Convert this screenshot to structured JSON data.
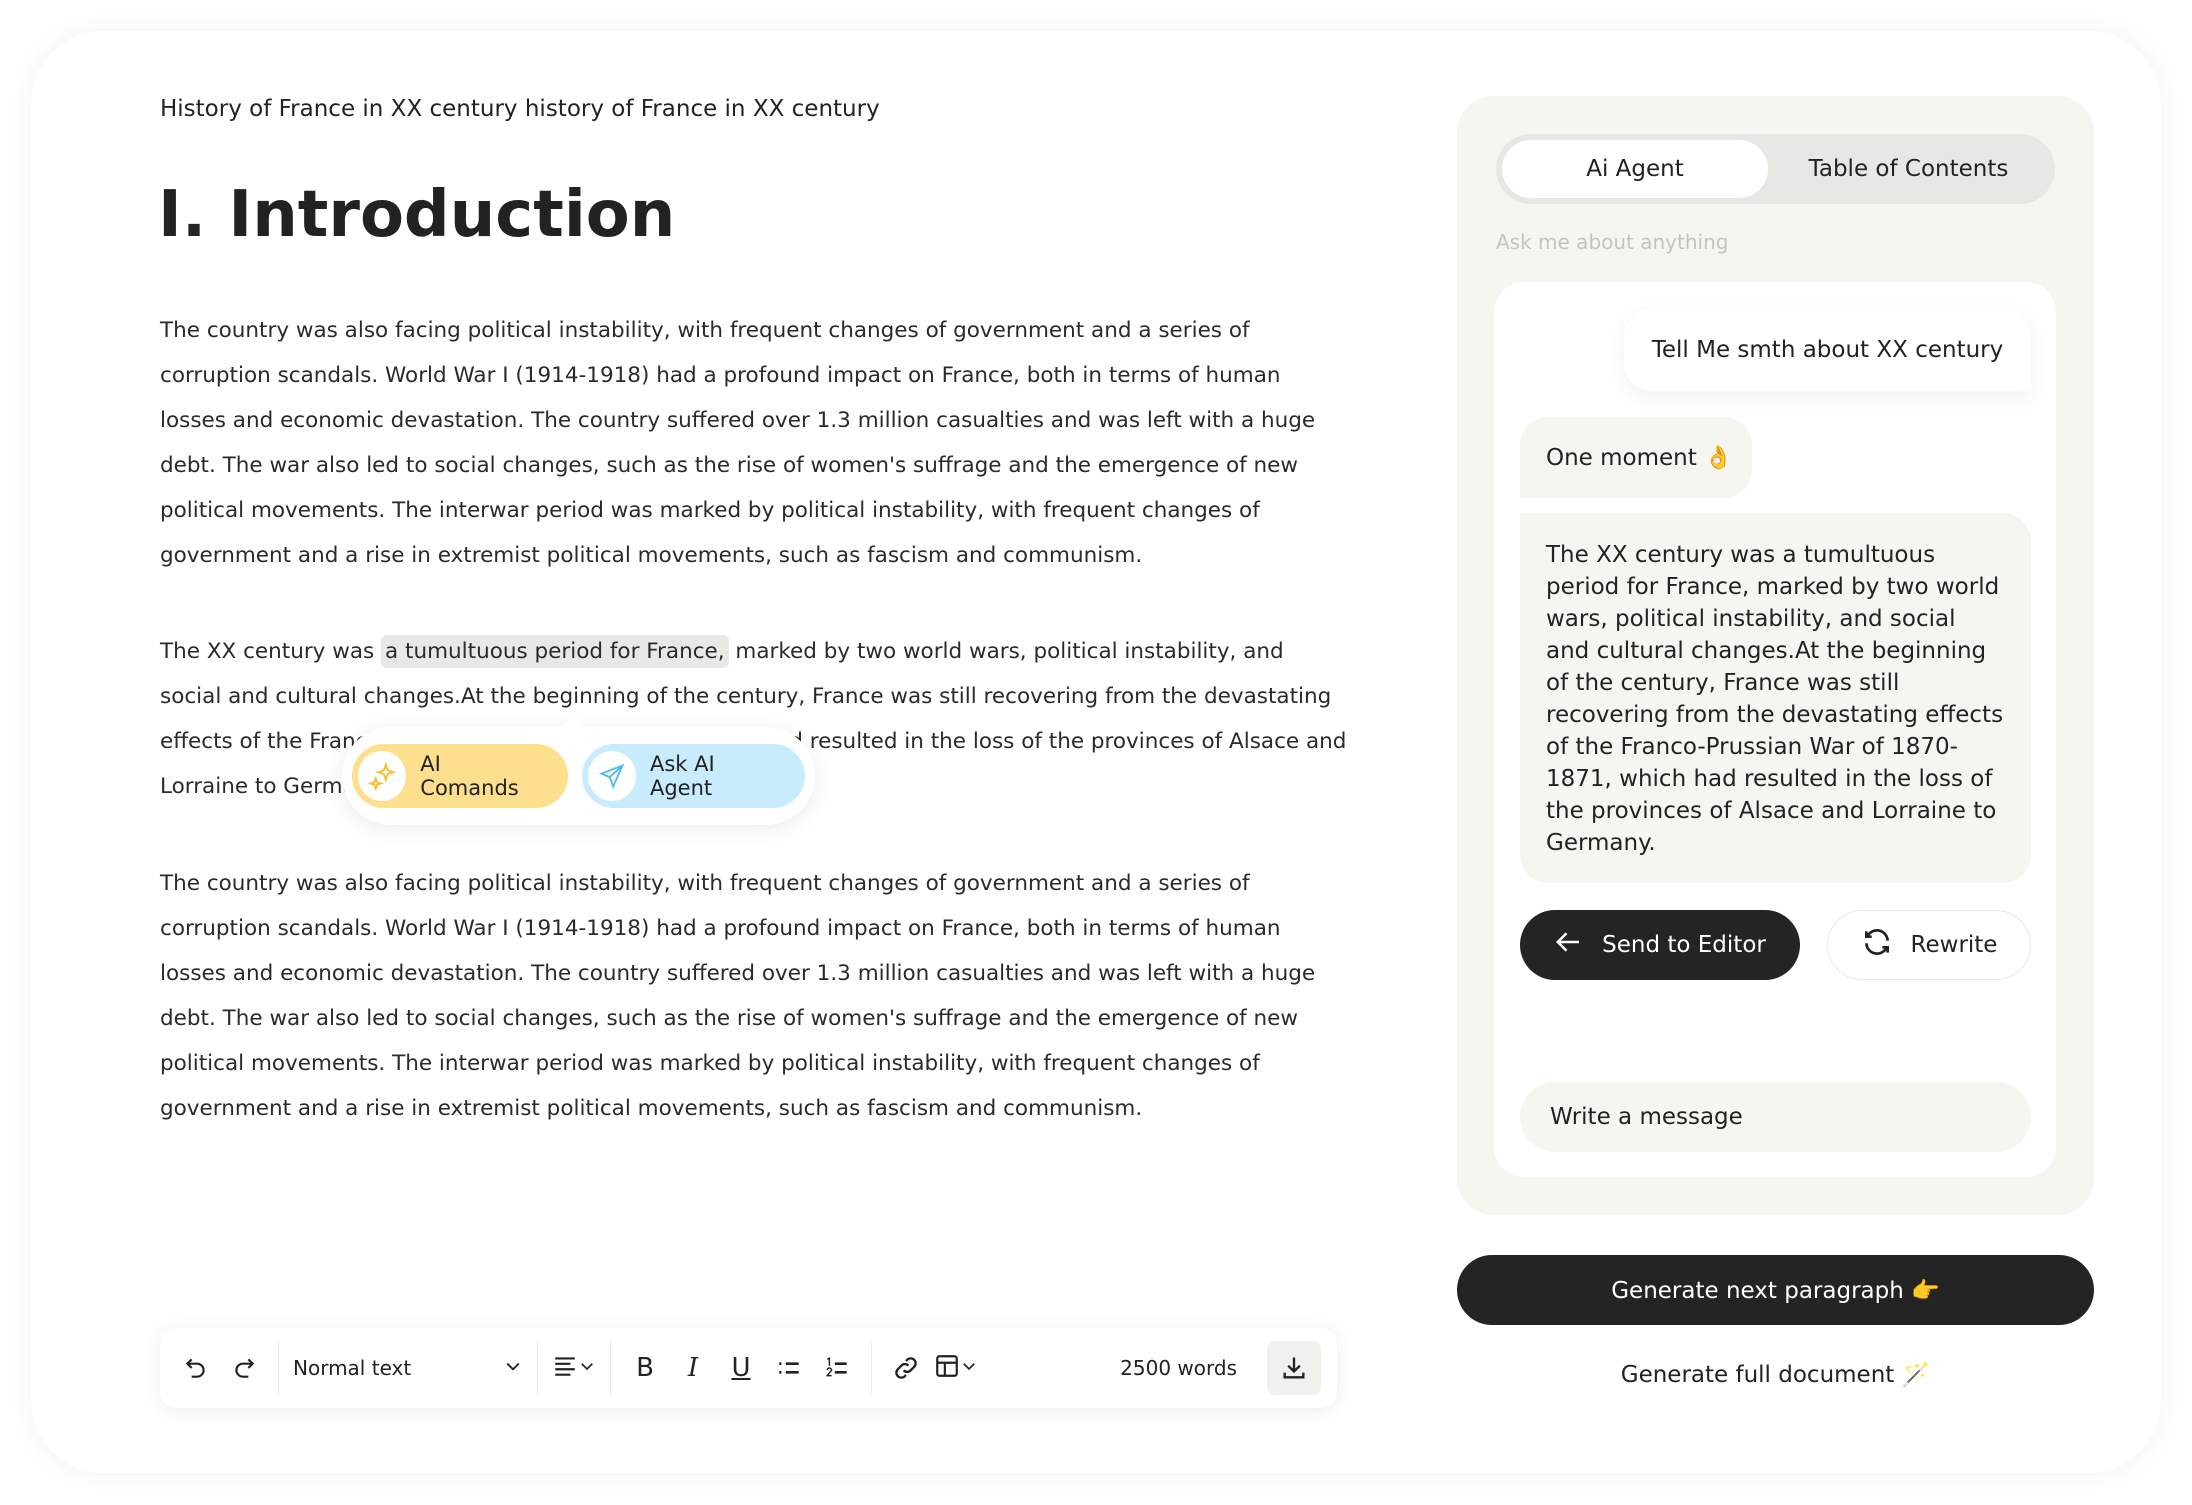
{
  "document": {
    "title": "History of France in XX century history of France in XX century",
    "heading": "I. Introduction",
    "paragraph1": "The country was also facing political instability, with frequent changes of government and a series of corruption scandals. World War I (1914-1918) had a profound impact on France, both in terms of human losses and economic devastation. The country suffered over 1.3 million casualties and was left with a huge debt. The war also led to social changes, such as the rise of women's suffrage and the emergence of new political movements. The interwar period was marked by political instability, with frequent changes of government and a rise in extremist political movements, such as fascism and communism.",
    "paragraph2_before": "The XX century was ",
    "paragraph2_selected": "a tumultuous period for France,",
    "paragraph2_after": " marked by two world wars, political instability, and social and cultural changes.At the beginning of the century, France was still recovering from the devastating effects of the Franco-Prussian War of 1870-1871, which had resulted in the loss of the provinces of Alsace and Lorraine to Germany.",
    "paragraph3": "The country was also facing political instability, with frequent changes of government and a series of corruption scandals. World War I (1914-1918) had a profound impact on France, both in terms of human losses and economic devastation. The country suffered over 1.3 million casualties and was left with a huge debt. The war also led to social changes, such as the rise of women's suffrage and the emergence of new political movements. The interwar period was marked by political instability, with frequent changes of government and a rise in extremist political movements, such as fascism and communism."
  },
  "popup": {
    "ai_commands": "AI Comands",
    "ask_agent": "Ask AI Agent",
    "ai_commands_color": "#fddf8e",
    "ask_agent_color": "#c8ecfd"
  },
  "toolbar": {
    "text_style": "Normal text",
    "word_count": "2500 words",
    "icons": [
      "undo-icon",
      "redo-icon",
      "align-left-icon",
      "bold-icon",
      "italic-icon",
      "underline-icon",
      "bullet-list-icon",
      "numbered-list-icon",
      "link-icon",
      "table-icon",
      "download-icon"
    ]
  },
  "panel": {
    "tabs": [
      {
        "label": "Ai Agent",
        "active": true
      },
      {
        "label": "Table of Contents",
        "active": false
      }
    ],
    "hint": "Ask me about anything",
    "messages": {
      "user": "Tell Me smth about XX century",
      "wait": "One moment 👌",
      "reply": "The XX century was a tumultuous period for France, marked by two world wars, political instability, and social and cultural changes.At the beginning of the century, France was still recovering from the devastating effects of the Franco-Prussian War of 1870-1871, which had resulted in the loss of the provinces of Alsace and Lorraine to Germany."
    },
    "send_to_editor": "Send to Editor",
    "rewrite": "Rewrite",
    "message_placeholder": "Write a message",
    "generate_next": "Generate next paragraph 👉",
    "generate_full": "Generate full document 🪄"
  }
}
